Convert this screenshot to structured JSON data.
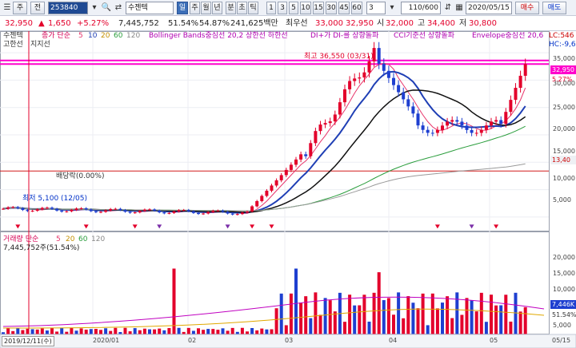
{
  "toolbar": {
    "menu": "주",
    "market": "전",
    "code": "253840",
    "name": "수젠텍",
    "period_active": "일",
    "periods": [
      "주",
      "월",
      "년",
      "분",
      "초",
      "틱"
    ],
    "minutes": [
      "1",
      "3",
      "5",
      "10",
      "15",
      "30",
      "45",
      "60"
    ],
    "count": "3",
    "range": "110/600",
    "date": "2020/05/15",
    "buy": "매수",
    "sell": "매도"
  },
  "quote": {
    "price": "32,950",
    "arrow": "▲",
    "change": "1,650",
    "change_pct": "+5.27%",
    "volume": "7,445,752",
    "vol_ratio1": "51.54%",
    "vol_ratio2": "54.87%",
    "amount": "241,625백만",
    "sell_label": "최우선",
    "ask": "33,000",
    "bid": "32,950",
    "open_label": "시",
    "open": "32,000",
    "high_label": "고",
    "high": "34,400",
    "low_label": "저",
    "low": "30,800"
  },
  "legend": {
    "name": "수젠텍",
    "ma": "종가 단순",
    "ma_periods": [
      "5",
      "10",
      "20",
      "60",
      "120"
    ],
    "boll": "Bollinger Bands중심선 20,2 상한선 하한선",
    "dmi": "DI+가 DI-를 상향돌파",
    "cci": "CCI기준선 상향돌파",
    "env": "Envelope중심선 20,6",
    "row2": [
      "고한선",
      "지지선"
    ],
    "lc": "LC:546",
    "hc": "HC:-9,6"
  },
  "annotations": {
    "high": "최고 36,550 (03/31)",
    "dividend": "배당락(0.00%)",
    "low_marker": "최저 5,100 (12/05)"
  },
  "price_axis": {
    "ticks": [
      "35,000",
      "30,000",
      "25,000",
      "20,000",
      "15,000",
      "10,000",
      "5,000"
    ],
    "current": "32,950",
    "current_pct": "5.27%",
    "line_tag": "13,40"
  },
  "volume_panel": {
    "title": "거래량 단순",
    "periods": [
      "5",
      "20",
      "60",
      "120"
    ],
    "value": "7,445,752주(51.54%)",
    "ticks": [
      "20,000",
      "15,000",
      "10,000",
      "5,000"
    ],
    "current_tag": "7,446K",
    "pct_tag": "51.54%"
  },
  "date_axis": {
    "start": "2019/12/11(수)",
    "labels": [
      "2020/01",
      "02",
      "03",
      "04",
      "05"
    ],
    "end": "05/15"
  },
  "colors": {
    "up": "#e3002b",
    "down": "#1e3fd0",
    "ma5": "#e8356b",
    "ma10": "#1f3fb5",
    "ma20": "#111111",
    "ma60": "#2a9d3c",
    "ma120": "#9a9a9a",
    "boll": "#e23c3c",
    "env": "#e23c3c",
    "resist": "#ff00cc",
    "support": "#d21a1a"
  },
  "chart_data": {
    "type": "candlestick",
    "x": [
      "2019/12/11",
      "05/15"
    ],
    "price_ylim": [
      2500,
      37500
    ],
    "last": {
      "open": 32000,
      "high": 34400,
      "low": 30800,
      "close": 32950
    },
    "high_point": {
      "value": 36550,
      "date": "03/31"
    },
    "resistance": [
      33600,
      32950
    ],
    "support": 13400,
    "volume_ylim": [
      0,
      24000
    ],
    "volume_unit": "K",
    "last_volume": 7446
  }
}
